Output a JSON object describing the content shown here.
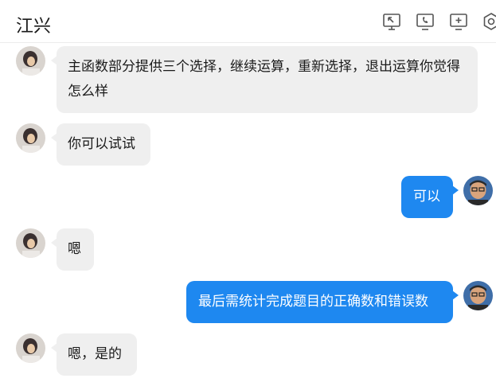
{
  "header": {
    "contact_name": "江兴",
    "icons": [
      "screen-share-icon",
      "phone-icon",
      "add-chat-icon",
      "settings-icon"
    ]
  },
  "messages": [
    {
      "side": "left",
      "sender": "contact",
      "text": "主函数部分提供三个选择，继续运算，重新选择，退出运算你觉得怎么样"
    },
    {
      "side": "left",
      "sender": "contact",
      "text": "你可以试试"
    },
    {
      "side": "right",
      "sender": "me",
      "text": "可以"
    },
    {
      "side": "left",
      "sender": "contact",
      "text": "嗯"
    },
    {
      "side": "right",
      "sender": "me",
      "text": "最后需统计完成题目的正确数和错误数"
    },
    {
      "side": "left",
      "sender": "contact",
      "text": "嗯，是的"
    }
  ],
  "colors": {
    "outgoing_bubble": "#1e88f0",
    "incoming_bubble": "#efefef",
    "header_icon": "#555555"
  }
}
